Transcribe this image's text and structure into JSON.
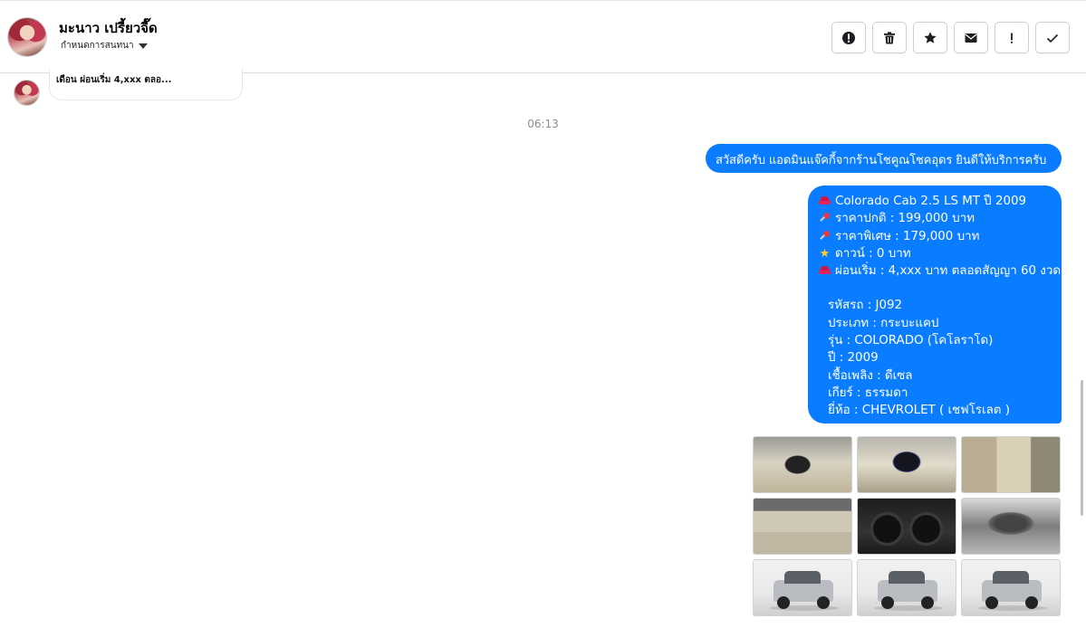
{
  "header": {
    "contact_name": "มะนาว เปรี้ยวจี๊ด",
    "conversation_label": "กำหนดการสนทนา",
    "actions": [
      {
        "name": "report-button",
        "icon": "alert-circle-icon"
      },
      {
        "name": "delete-button",
        "icon": "trash-icon"
      },
      {
        "name": "star-button",
        "icon": "star-icon"
      },
      {
        "name": "mark-unread-button",
        "icon": "envelope-icon"
      },
      {
        "name": "important-button",
        "icon": "exclamation-icon"
      },
      {
        "name": "done-button",
        "icon": "check-icon"
      }
    ]
  },
  "previous_message": {
    "text": "เดือน ผ่อนเริ่ม 4,xxx ตลอ..."
  },
  "timestamp": "06:13",
  "messages": {
    "greeting": "สวัสดีครับ แอดมินแจ๊คกี้จากร้านโชคูณโชคอุดร ยินดีให้บริการครับ",
    "details": {
      "title": "Colorado Cab 2.5 LS MT ปี 2009",
      "regular_price": "ราคาปกติ : 199,000 บาท",
      "special_price": "ราคาพิเศษ : 179,000 บาท",
      "down_payment": "ดาวน์ : 0 บาท",
      "installment": "ผ่อนเริ่ม : 4,xxx บาท ตลอดสัญญา 60 งวด",
      "car_code": "รหัสรถ : J092",
      "type": "ประเภท : กระบะแคป",
      "model": "รุ่น : COLORADO (โคโลราโด)",
      "year": "ปี : 2009",
      "fuel": "เชื้อเพลิง : ดีเซล",
      "gear": "เกียร์ : ธรรมดา",
      "brand": "ยี่ห้อ : CHEVROLET ( เชฟโรเลต )"
    }
  },
  "colors": {
    "bubble_blue": "#0a7cff",
    "timestamp_gray": "#8a8d91"
  }
}
